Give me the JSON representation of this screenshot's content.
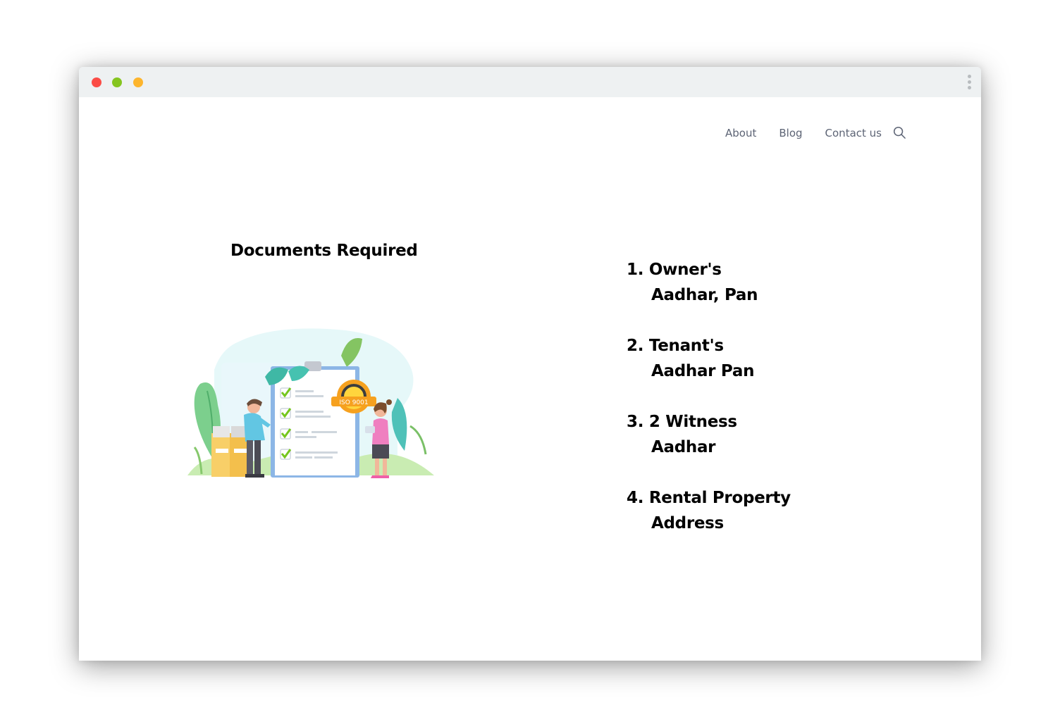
{
  "window": {
    "controls": [
      "close-dot",
      "minimize-dot",
      "maximize-dot"
    ],
    "control_colors": {
      "close": "#fb4c46",
      "minimize": "#85c51f",
      "maximize": "#fdb52d"
    }
  },
  "nav": {
    "about": "About",
    "blog": "Blog",
    "contact": "Contact us",
    "search_icon": "search-icon"
  },
  "section": {
    "heading": "Documents Required",
    "illustration_icon": "checklist-illustration",
    "badge_text": "ISO 9001"
  },
  "documents": [
    {
      "number": "1.",
      "line1": "Owner's",
      "line2": "Aadhar, Pan"
    },
    {
      "number": "2.",
      "line1": "Tenant's",
      "line2": "Aadhar Pan"
    },
    {
      "number": "3.",
      "line1": "2 Witness",
      "line2": "Aadhar"
    },
    {
      "number": "4.",
      "line1": "Rental Property",
      "line2": "Address"
    }
  ]
}
